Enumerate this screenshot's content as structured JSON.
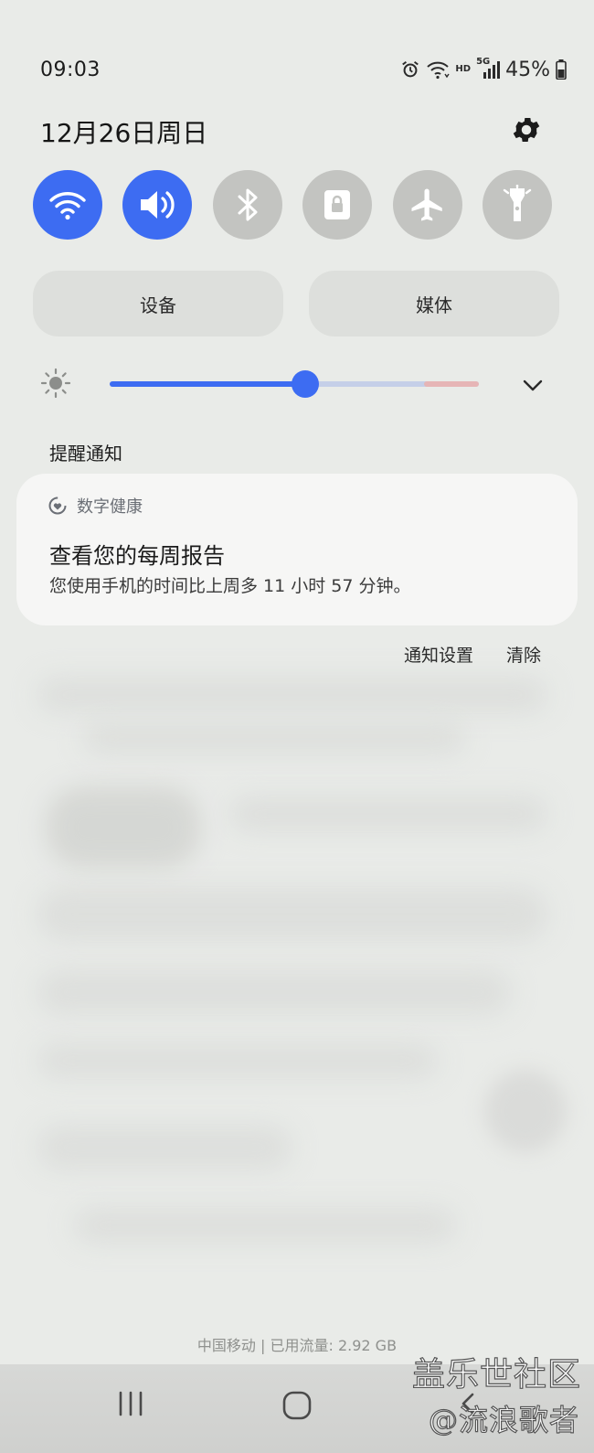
{
  "status_bar": {
    "time": "09:03",
    "hd_label": "HD",
    "network_label": "5G",
    "battery": "45%"
  },
  "header": {
    "date": "12月26日周日"
  },
  "quick_toggles": [
    {
      "name": "wifi",
      "icon": "wifi-icon",
      "on": true
    },
    {
      "name": "sound",
      "icon": "speaker-icon",
      "on": true
    },
    {
      "name": "bluetooth",
      "icon": "bluetooth-icon",
      "on": false
    },
    {
      "name": "rotation-lock",
      "icon": "lock-icon",
      "on": false
    },
    {
      "name": "airplane",
      "icon": "airplane-icon",
      "on": false
    },
    {
      "name": "flashlight",
      "icon": "flashlight-icon",
      "on": false
    }
  ],
  "panels": {
    "devices_label": "设备",
    "media_label": "媒体"
  },
  "brightness": {
    "level": 0.53
  },
  "notifications": {
    "section_title": "提醒通知",
    "card": {
      "app_name": "数字健康",
      "title": "查看您的每周报告",
      "text": "您使用手机的时间比上周多 11 小时 57 分钟。"
    },
    "settings_label": "通知设置",
    "clear_label": "清除"
  },
  "footer": {
    "carrier_info": "中国移动 | 已用流量: 2.92 GB"
  },
  "watermark": {
    "line1": "盖乐世社区",
    "line2": "@流浪歌者"
  },
  "colors": {
    "accent": "#3d6cf2",
    "toggle_off": "#c3c4c1",
    "background": "#e9ebe8"
  }
}
